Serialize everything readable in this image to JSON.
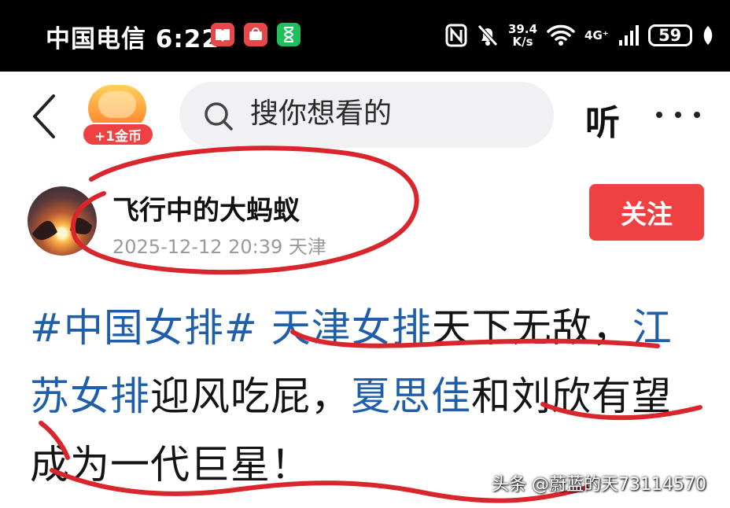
{
  "status_bar": {
    "carrier_time": "中国电信 6:22",
    "app_icons": [
      "book-app-icon",
      "shopping-app-icon",
      "hourglass-app-icon"
    ],
    "network_speed_value": "39.4",
    "network_speed_unit": "K/s",
    "network_type": "4G⁺",
    "battery_level": "59"
  },
  "nav": {
    "coin_reward": "+1金币",
    "search_placeholder": "搜你想看的",
    "listen_label": "听"
  },
  "author": {
    "name": "飞行中的大蚂蚁",
    "meta": "2025-12-12 20:39 天津",
    "follow_label": "关注"
  },
  "post": {
    "hashtag": "#中国女排#",
    "segments": [
      {
        "text": "天津女排",
        "link": true
      },
      {
        "text": "天下无敌，",
        "link": false
      },
      {
        "text": "江苏女排",
        "link": true
      },
      {
        "text": "迎风吃屁，",
        "link": false
      },
      {
        "text": "夏思佳",
        "link": true
      },
      {
        "text": "和刘欣有望成为一代巨星！",
        "link": false
      }
    ]
  },
  "watermark": "头条 @蔚蓝的天73114570",
  "colors": {
    "accent_red": "#f04142",
    "link_blue": "#1f5ea8",
    "annotation_red": "#d9262c"
  }
}
